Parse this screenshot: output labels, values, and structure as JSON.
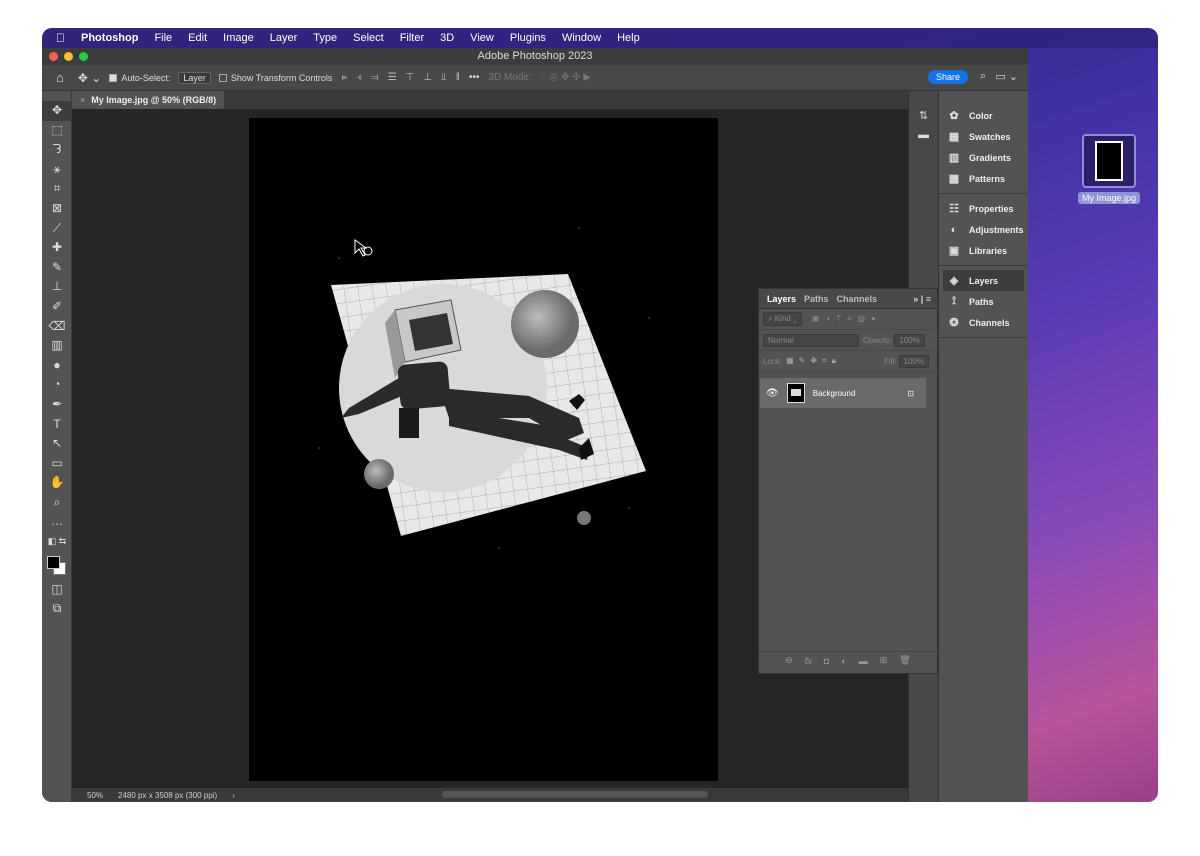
{
  "menubar": {
    "apple": "",
    "app": "Photoshop",
    "items": [
      "File",
      "Edit",
      "Image",
      "Layer",
      "Type",
      "Select",
      "Filter",
      "3D",
      "View",
      "Plugins",
      "Window",
      "Help"
    ]
  },
  "window": {
    "title": "Adobe Photoshop 2023"
  },
  "options": {
    "auto_select_label": "Auto-Select:",
    "auto_select_value": "Layer",
    "show_transform": "Show Transform Controls",
    "more": "•••",
    "mode3d": "3D Mode:",
    "share": "Share"
  },
  "document": {
    "tab": "My Image.jpg @ 50% (RGB/8)"
  },
  "status": {
    "zoom": "50%",
    "info": "2480 px x 3508 px (300 ppi)",
    "arrow": "›"
  },
  "right_panels": {
    "group1": [
      "Color",
      "Swatches",
      "Gradients",
      "Patterns"
    ],
    "group2": [
      "Properties",
      "Adjustments",
      "Libraries"
    ],
    "group3": [
      "Layers",
      "Paths",
      "Channels"
    ]
  },
  "layers_panel": {
    "tabs": [
      "Layers",
      "Paths",
      "Channels"
    ],
    "kind": "Kind",
    "blend": "Normal",
    "opacity_label": "Opacity:",
    "opacity": "100%",
    "lock_label": "Lock:",
    "fill_label": "Fill:",
    "fill": "100%",
    "layer_name": "Background"
  },
  "desktop": {
    "file": "My Image.jpg"
  },
  "colors": {
    "accent": "#1473e6",
    "panel": "#535353",
    "canvas_bg": "#262626"
  }
}
